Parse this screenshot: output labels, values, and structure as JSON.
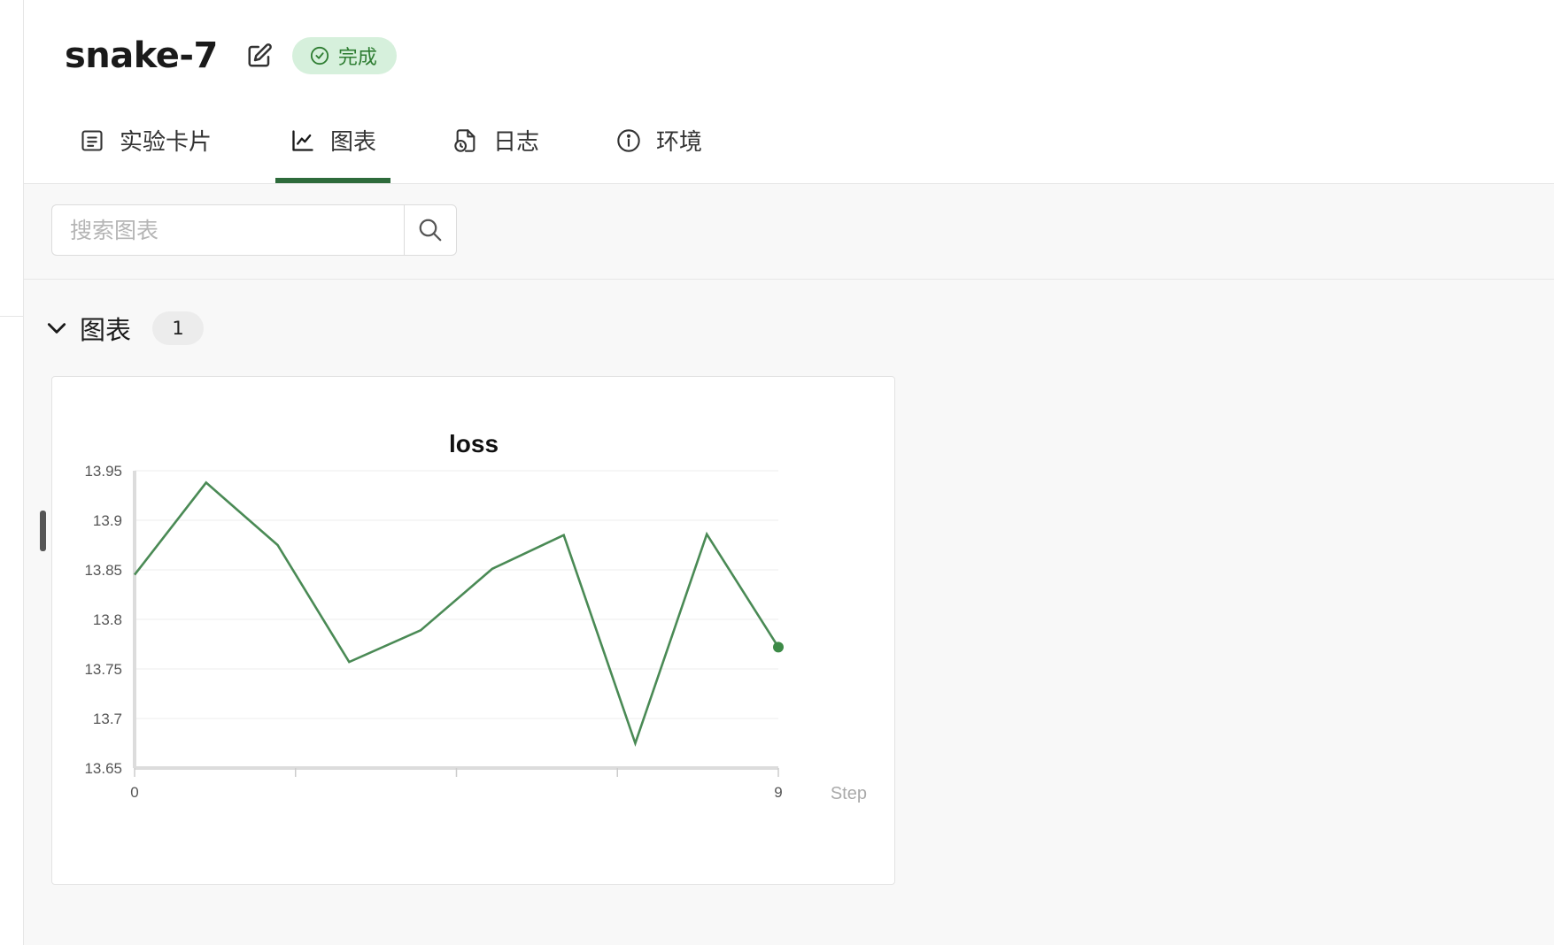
{
  "run": {
    "title": "snake-7",
    "status": "完成",
    "status_color": "#2e7d32",
    "status_bg": "#d6f0dc"
  },
  "tabs": [
    {
      "label": "实验卡片",
      "icon": "card-icon",
      "active": false
    },
    {
      "label": "图表",
      "icon": "line-chart-icon",
      "active": true
    },
    {
      "label": "日志",
      "icon": "log-file-icon",
      "active": false
    },
    {
      "label": "环境",
      "icon": "info-icon",
      "active": false
    }
  ],
  "search": {
    "placeholder": "搜索图表",
    "value": ""
  },
  "section": {
    "title": "图表",
    "count": "1"
  },
  "accent_color": "#2e6b3b",
  "chart_data": {
    "type": "line",
    "title": "loss",
    "xlabel": "Step",
    "ylabel": "",
    "x": [
      0,
      1,
      2,
      3,
      4,
      5,
      6,
      7,
      8,
      9
    ],
    "series": [
      {
        "values": [
          13.845,
          13.938,
          13.875,
          13.757,
          13.789,
          13.851,
          13.885,
          13.675,
          13.886,
          13.772
        ],
        "color": "#4a8a55"
      }
    ],
    "xlim": [
      0,
      9
    ],
    "ylim": [
      13.65,
      13.95
    ],
    "x_tick_labels": [
      "0",
      "9"
    ],
    "y_tick_labels": [
      "13.95",
      "13.9",
      "13.85",
      "13.8",
      "13.75",
      "13.7",
      "13.65"
    ],
    "grid": true,
    "last_point_marker": true
  }
}
